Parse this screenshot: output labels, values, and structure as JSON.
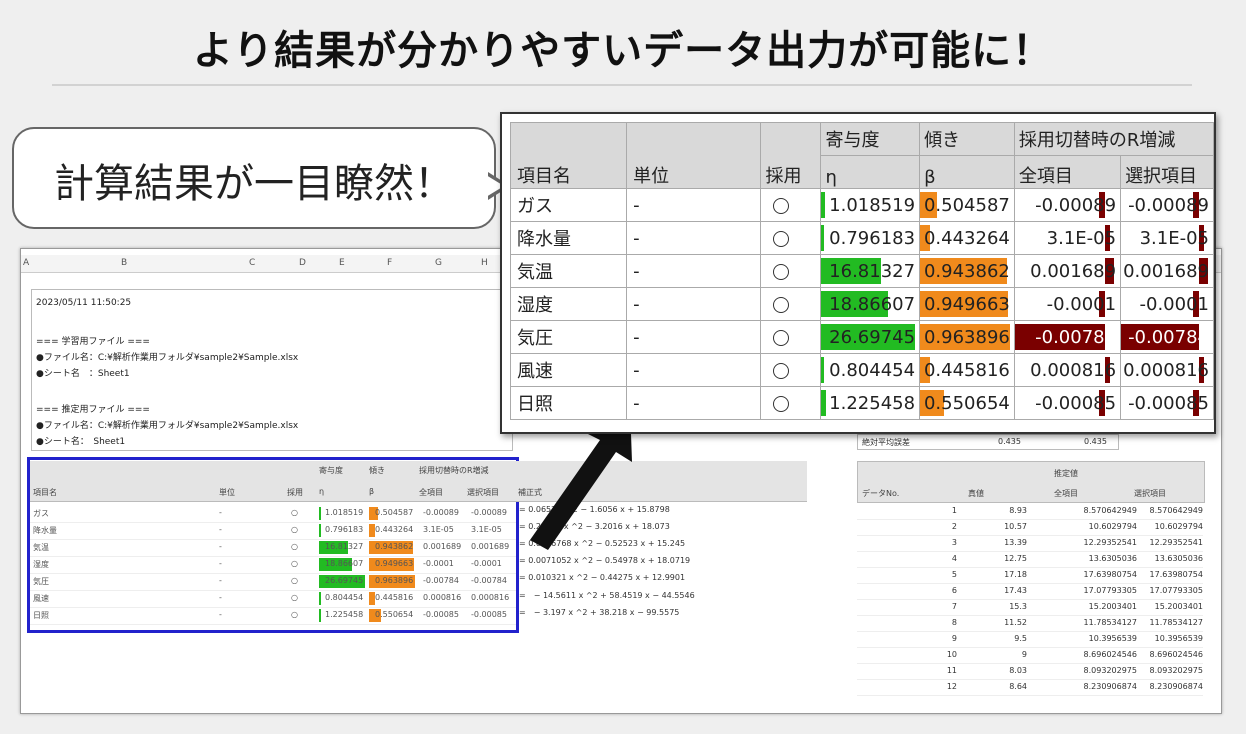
{
  "title": "より結果が分かりやすいデータ出力が可能に！",
  "bubble_text": "計算結果が一目瞭然！",
  "colors": {
    "green": "#22bb22",
    "orange": "#f08a1c",
    "darkred": "#7a0000",
    "blue": "#2222cc"
  },
  "sheet": {
    "col_letters": [
      "A",
      "B",
      "C",
      "D",
      "E",
      "F",
      "G",
      "H"
    ],
    "log": [
      "2023/05/11 11:50:25",
      "=== 学習用ファイル ===",
      "●ファイル名：C:¥解析作業用フォルダ¥sample2¥Sample.xlsx",
      "●シート名　：Sheet1",
      "=== 推定用ファイル ===",
      "●ファイル名：C:¥解析作業用フォルダ¥sample2¥Sample.xlsx",
      "●シート名：　Sheet1"
    ],
    "formula_header": "補正式",
    "formulas": [
      "= 0.0652 x ^2 − 1.6056 x + 15.8798",
      "= 0.25815 x ^2 − 3.2016 x + 18.073",
      "= 0.0096768 x ^2 − 0.52523 x + 15.245",
      "= 0.0071052 x ^2 − 0.54978 x + 18.0719",
      "= 0.010321 x ^2 − 0.44275 x + 12.9901",
      "=　− 14.5611 x ^2 + 58.4519 x − 44.5546",
      "=　− 3.197 x ^2 + 38.218 x − 99.5575"
    ],
    "abs_label": "絶対平均誤差",
    "abs_values": [
      "0.435",
      "0.435"
    ],
    "right_headers": {
      "no": "データNo.",
      "actual": "真値",
      "est": "推定値",
      "all": "全項目",
      "sel": "選択項目"
    },
    "right_rows": [
      {
        "no": "1",
        "actual": "8.93",
        "all": "8.570642949",
        "sel": "8.570642949"
      },
      {
        "no": "2",
        "actual": "10.57",
        "all": "10.6029794",
        "sel": "10.6029794"
      },
      {
        "no": "3",
        "actual": "13.39",
        "all": "12.29352541",
        "sel": "12.29352541"
      },
      {
        "no": "4",
        "actual": "12.75",
        "all": "13.6305036",
        "sel": "13.6305036"
      },
      {
        "no": "5",
        "actual": "17.18",
        "all": "17.63980754",
        "sel": "17.63980754"
      },
      {
        "no": "6",
        "actual": "17.43",
        "all": "17.07793305",
        "sel": "17.07793305"
      },
      {
        "no": "7",
        "actual": "15.3",
        "all": "15.2003401",
        "sel": "15.2003401"
      },
      {
        "no": "8",
        "actual": "11.52",
        "all": "11.78534127",
        "sel": "11.78534127"
      },
      {
        "no": "9",
        "actual": "9.5",
        "all": "10.3956539",
        "sel": "10.3956539"
      },
      {
        "no": "10",
        "actual": "9",
        "all": "8.696024546",
        "sel": "8.696024546"
      },
      {
        "no": "11",
        "actual": "8.03",
        "all": "8.093202975",
        "sel": "8.093202975"
      },
      {
        "no": "12",
        "actual": "8.64",
        "all": "8.230906874",
        "sel": "8.230906874"
      }
    ]
  },
  "zoom_table": {
    "headers": {
      "item": "項目名",
      "unit": "単位",
      "adopt": "採用",
      "contrib_top": "寄与度",
      "contrib_sym": "η",
      "slope_top": "傾き",
      "slope_sym": "β",
      "rinc_top": "採用切替時のR増減",
      "rinc_all": "全項目",
      "rinc_sel": "選択項目"
    },
    "rows": [
      {
        "name": "ガス",
        "unit": "-",
        "contrib": "1.018519",
        "contrib_v": 1.018519,
        "slope": "0.504587",
        "slope_v": 0.504587,
        "all": "-0.00089",
        "sel": "-0.00089"
      },
      {
        "name": "降水量",
        "unit": "-",
        "contrib": "0.796183",
        "contrib_v": 0.796183,
        "slope": "0.443264",
        "slope_v": 0.443264,
        "all": "3.1E-05",
        "sel": "3.1E-05"
      },
      {
        "name": "気温",
        "unit": "-",
        "contrib": "16.81327",
        "contrib_v": 16.81327,
        "slope": "0.943862",
        "slope_v": 0.943862,
        "all": "0.001689",
        "sel": "0.001689"
      },
      {
        "name": "湿度",
        "unit": "-",
        "contrib": "18.86607",
        "contrib_v": 18.86607,
        "slope": "0.949663",
        "slope_v": 0.949663,
        "all": "-0.0001",
        "sel": "-0.0001"
      },
      {
        "name": "気圧",
        "unit": "-",
        "contrib": "26.69745",
        "contrib_v": 26.69745,
        "slope": "0.963896",
        "slope_v": 0.963896,
        "all": "-0.00784",
        "sel": "-0.00784"
      },
      {
        "name": "風速",
        "unit": "-",
        "contrib": "0.804454",
        "contrib_v": 0.804454,
        "slope": "0.445816",
        "slope_v": 0.445816,
        "all": "0.000816",
        "sel": "0.000816"
      },
      {
        "name": "日照",
        "unit": "-",
        "contrib": "1.225458",
        "contrib_v": 1.225458,
        "slope": "0.550654",
        "slope_v": 0.550654,
        "all": "-0.00085",
        "sel": "-0.00085"
      }
    ]
  }
}
